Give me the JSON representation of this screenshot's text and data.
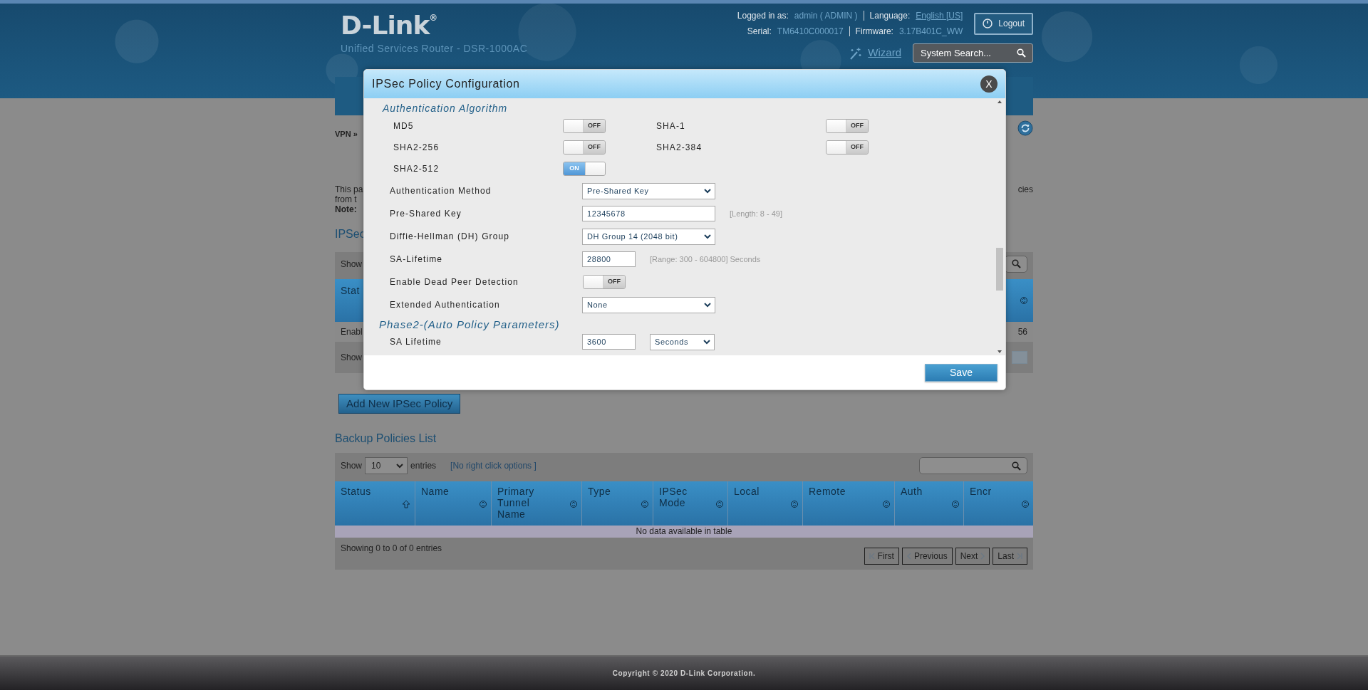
{
  "header": {
    "logo": "D-Link$^{®}$",
    "subtitle": "Unified Services Router - DSR-1000AC",
    "logged_in_label": "Logged in as:",
    "user": "admin ( ADMIN )",
    "language_label": "Language:",
    "language": "English [US]",
    "logout": "Logout",
    "serial_label": "Serial:",
    "serial": "TM6410C000017",
    "firmware_label": "Firmware:",
    "firmware": "3.17B401C_WW",
    "wizard": "Wizard",
    "search": {
      "placeholder": "System Search..."
    }
  },
  "background": {
    "breadcrumb": "VPN »",
    "description_fragments": [
      "This pa",
      "from t"
    ],
    "note_fragment": "Note:",
    "description_right_fragment": "cies",
    "section_fragment": "IPSec",
    "show_fragment": "Show",
    "column_fragment": "Stat",
    "row_fragment": "Enabl",
    "row_right_fragment": "56",
    "footer_fragment": "Show",
    "add_button": "Add New IPSec Policy"
  },
  "backup": {
    "title": "Backup Policies List",
    "show_label": "Show",
    "page_size": "10",
    "entries_label": "entries",
    "no_right_click": "[No right click options ]",
    "columns": [
      {
        "label": "Status",
        "sorted": true
      },
      {
        "label": "Name",
        "sorted": false
      },
      {
        "label": "Primary Tunnel Name",
        "sorted": false
      },
      {
        "label": "Type",
        "sorted": false
      },
      {
        "label": "IPSec Mode",
        "sorted": false
      },
      {
        "label": "Local",
        "sorted": false
      },
      {
        "label": "Remote",
        "sorted": false
      },
      {
        "label": "Auth",
        "sorted": false
      },
      {
        "label": "Encr",
        "sorted": false
      }
    ],
    "empty_message": "No data available in table",
    "summary": "Showing 0 to 0 of 0 entries",
    "pager": [
      {
        "label": "First",
        "kind": "first",
        "disabled": true
      },
      {
        "label": "Previous",
        "kind": "prev",
        "disabled": true
      },
      {
        "label": "Next",
        "kind": "next",
        "disabled": true
      },
      {
        "label": "Last",
        "kind": "last",
        "disabled": true
      }
    ]
  },
  "modal": {
    "title": "IPSec Policy Configuration",
    "close": "X",
    "auth_algorithm": {
      "heading": "Authentication Algorithm",
      "options": [
        {
          "label": "MD5",
          "on": false,
          "switch_text": "OFF"
        },
        {
          "label": "SHA-1",
          "on": false,
          "switch_text": "OFF"
        },
        {
          "label": "SHA2-256",
          "on": false,
          "switch_text": "OFF"
        },
        {
          "label": "SHA2-384",
          "on": false,
          "switch_text": "OFF"
        },
        {
          "label": "SHA2-512",
          "on": true,
          "switch_text": "ON"
        }
      ]
    },
    "fields": [
      {
        "kind": "select",
        "label": "Authentication Method",
        "value": "Pre-Shared Key"
      },
      {
        "kind": "input",
        "label": "Pre-Shared Key",
        "value": "12345678",
        "hint": "[Length: 8 - 49]"
      },
      {
        "kind": "select",
        "label": "Diffie-Hellman (DH) Group",
        "value": "DH Group 14 (2048 bit)"
      },
      {
        "kind": "short_input",
        "label": "SA-Lifetime",
        "value": "28800",
        "hint": "[Range: 300 - 604800] Seconds"
      },
      {
        "kind": "switch",
        "label": "Enable Dead Peer Detection",
        "on": false,
        "switch_text": "OFF"
      },
      {
        "kind": "select",
        "label": "Extended Authentication",
        "value": "None"
      }
    ],
    "phase2": {
      "heading": "Phase2-(Auto Policy Parameters)",
      "fields": [
        {
          "kind": "short_input_unit",
          "label": "SA Lifetime",
          "value": "3600",
          "unit": "Seconds"
        }
      ]
    },
    "save": "Save"
  },
  "footer": {
    "copyright": "Copyright © 2020 D-Link Corporation."
  }
}
